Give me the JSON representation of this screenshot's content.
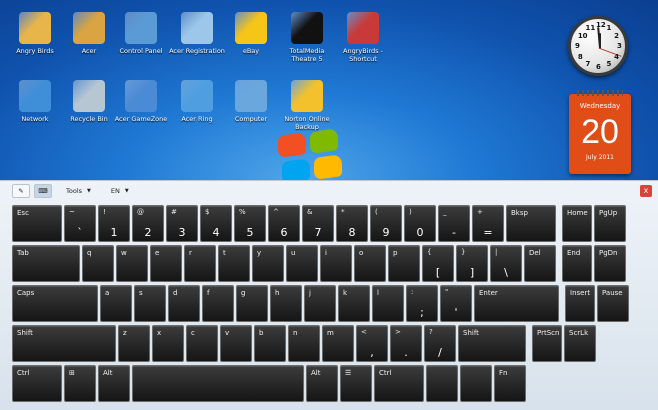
{
  "desktop": {
    "icons": [
      {
        "label": "Angry Birds",
        "icon": "folder-icon",
        "color": "#e8b54a"
      },
      {
        "label": "Acer",
        "icon": "acer-folder-icon",
        "color": "#d9a441"
      },
      {
        "label": "Control Panel",
        "icon": "control-panel-icon",
        "color": "#5b9bd5"
      },
      {
        "label": "Acer Registration",
        "icon": "registration-icon",
        "color": "#9cc7ea"
      },
      {
        "label": "eBay",
        "icon": "ebay-icon",
        "color": "#f5c518"
      },
      {
        "label": "TotalMedia Theatre 5",
        "icon": "media-player-icon",
        "color": "#111111"
      },
      {
        "label": "AngryBirds - Shortcut",
        "icon": "angry-birds-icon",
        "color": "#c83a3a"
      },
      {
        "label": "Network",
        "icon": "network-icon",
        "color": "#3f8fd8"
      },
      {
        "label": "Recycle Bin",
        "icon": "recycle-bin-icon",
        "color": "#b7c6d3"
      },
      {
        "label": "Acer GameZone",
        "icon": "gamezone-icon",
        "color": "#4b8ad4"
      },
      {
        "label": "Acer Ring",
        "icon": "acer-ring-icon",
        "color": "#4f9fe0"
      },
      {
        "label": "Computer",
        "icon": "computer-icon",
        "color": "#6aa7dc"
      },
      {
        "label": "Norton Online Backup",
        "icon": "norton-icon",
        "color": "#f3c12c"
      }
    ],
    "clock": {
      "numbers": [
        "12",
        "1",
        "2",
        "3",
        "4",
        "5",
        "6",
        "7",
        "8",
        "9",
        "10",
        "11"
      ]
    },
    "calendar": {
      "day": "Wednesday",
      "date": "20",
      "month": "July 2011"
    }
  },
  "keyboard": {
    "toolbar": {
      "tools_label": "Tools",
      "lang_label": "EN",
      "close": "x"
    },
    "rows": [
      [
        {
          "k": "Esc"
        },
        {
          "t": "~",
          "m": "`"
        },
        {
          "t": "!",
          "m": "1"
        },
        {
          "t": "@",
          "m": "2"
        },
        {
          "t": "#",
          "m": "3"
        },
        {
          "t": "$",
          "m": "4"
        },
        {
          "t": "%",
          "m": "5"
        },
        {
          "t": "^",
          "m": "6"
        },
        {
          "t": "&",
          "m": "7"
        },
        {
          "t": "*",
          "m": "8"
        },
        {
          "t": "(",
          "m": "9"
        },
        {
          "t": ")",
          "m": "0"
        },
        {
          "t": "_",
          "m": "-"
        },
        {
          "t": "+",
          "m": "="
        },
        {
          "k": "Bksp"
        },
        {
          "k": "Home"
        },
        {
          "k": "PgUp"
        }
      ],
      [
        {
          "k": "Tab"
        },
        {
          "k": "q"
        },
        {
          "k": "w"
        },
        {
          "k": "e"
        },
        {
          "k": "r"
        },
        {
          "k": "t"
        },
        {
          "k": "y"
        },
        {
          "k": "u"
        },
        {
          "k": "i"
        },
        {
          "k": "o"
        },
        {
          "k": "p"
        },
        {
          "t": "{",
          "m": "["
        },
        {
          "t": "}",
          "m": "]"
        },
        {
          "t": "|",
          "m": "\\"
        },
        {
          "k": "Del"
        },
        {
          "k": "End"
        },
        {
          "k": "PgDn"
        }
      ],
      [
        {
          "k": "Caps"
        },
        {
          "k": "a"
        },
        {
          "k": "s"
        },
        {
          "k": "d"
        },
        {
          "k": "f"
        },
        {
          "k": "g"
        },
        {
          "k": "h"
        },
        {
          "k": "j"
        },
        {
          "k": "k"
        },
        {
          "k": "l"
        },
        {
          "t": ":",
          "m": ";"
        },
        {
          "t": "\"",
          "m": "'"
        },
        {
          "k": "Enter"
        },
        {
          "k": "Insert"
        },
        {
          "k": "Pause"
        }
      ],
      [
        {
          "k": "Shift"
        },
        {
          "k": "z"
        },
        {
          "k": "x"
        },
        {
          "k": "c"
        },
        {
          "k": "v"
        },
        {
          "k": "b"
        },
        {
          "k": "n"
        },
        {
          "k": "m"
        },
        {
          "t": "<",
          "m": ","
        },
        {
          "t": ">",
          "m": "."
        },
        {
          "t": "?",
          "m": "/"
        },
        {
          "k": "Shift"
        },
        {
          "k": "PrtScn"
        },
        {
          "k": "ScrLk"
        }
      ],
      [
        {
          "k": "Ctrl"
        },
        {
          "k": "Win",
          "icon": "windows-logo-icon"
        },
        {
          "k": "Alt"
        },
        {
          "k": ""
        },
        {
          "k": "Alt"
        },
        {
          "k": "Menu",
          "icon": "menu-icon"
        },
        {
          "k": "Ctrl"
        },
        {
          "k": ""
        },
        {
          "k": ""
        },
        {
          "k": "Fn"
        }
      ]
    ]
  }
}
